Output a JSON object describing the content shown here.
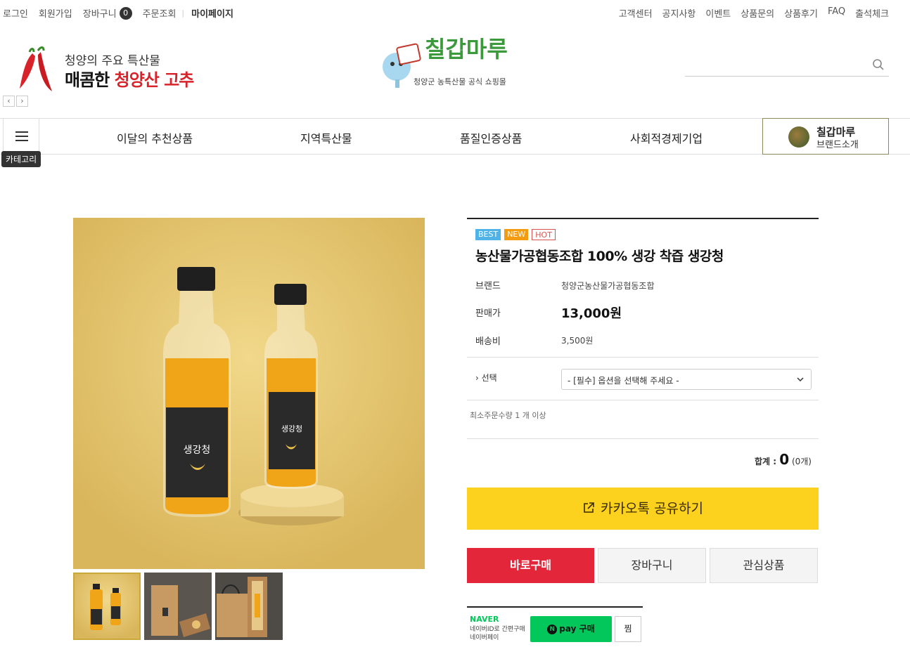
{
  "topbar": {
    "left": [
      "로그인",
      "회원가입",
      "장바구니"
    ],
    "cart_count": "0",
    "order": "주문조회",
    "mypage": "마이페이지",
    "right": [
      "고객센터",
      "공지사항",
      "이벤트",
      "상품문의",
      "상품후기",
      "FAQ",
      "출석체크"
    ]
  },
  "banner": {
    "sub": "청양의 주요 특산물",
    "main_a": "매콤한 ",
    "main_b": "청양산 고추"
  },
  "logo": {
    "brand": "칠갑마루",
    "tagline": "청양군 농특산물 공식 쇼핑몰"
  },
  "search": {
    "placeholder": ""
  },
  "nav": {
    "category_tip": "카테고리",
    "items": [
      "이달의 추천상품",
      "지역특산물",
      "품질인증상품",
      "사회적경제기업"
    ],
    "brand_title": "칠갑마루",
    "brand_sub": "브랜드소개"
  },
  "product": {
    "badges": [
      "BEST",
      "NEW",
      "HOT"
    ],
    "title": "농산물가공협동조합 100% 생강 착즙 생강청",
    "brand_label": "브랜드",
    "brand_value": "청양군농산물가공협동조합",
    "price_label": "판매가",
    "price_value": "13,000원",
    "shipping_label": "배송비",
    "shipping_value": "3,500원",
    "option_label": "선택",
    "option_value": "- [필수] 옵션을 선택해 주세요 -",
    "min_order": "최소주문수량 1 개 이상",
    "total_label": "합계 : ",
    "total_value": "0",
    "total_count": "(0개)",
    "kakao": "카카오톡 공유하기",
    "buy": "바로구매",
    "cart": "장바구니",
    "wish": "관심상품",
    "label_text": "생강청"
  },
  "naver": {
    "logo": "NAVER",
    "line1": "네이버ID로 간편구매",
    "line2": "네이버페이",
    "pay": "pay 구매",
    "zzim": "찜"
  },
  "colors": {
    "accent_red": "#e4263a",
    "kakao_yellow": "#fcd21e",
    "naver_green": "#03c75a"
  }
}
